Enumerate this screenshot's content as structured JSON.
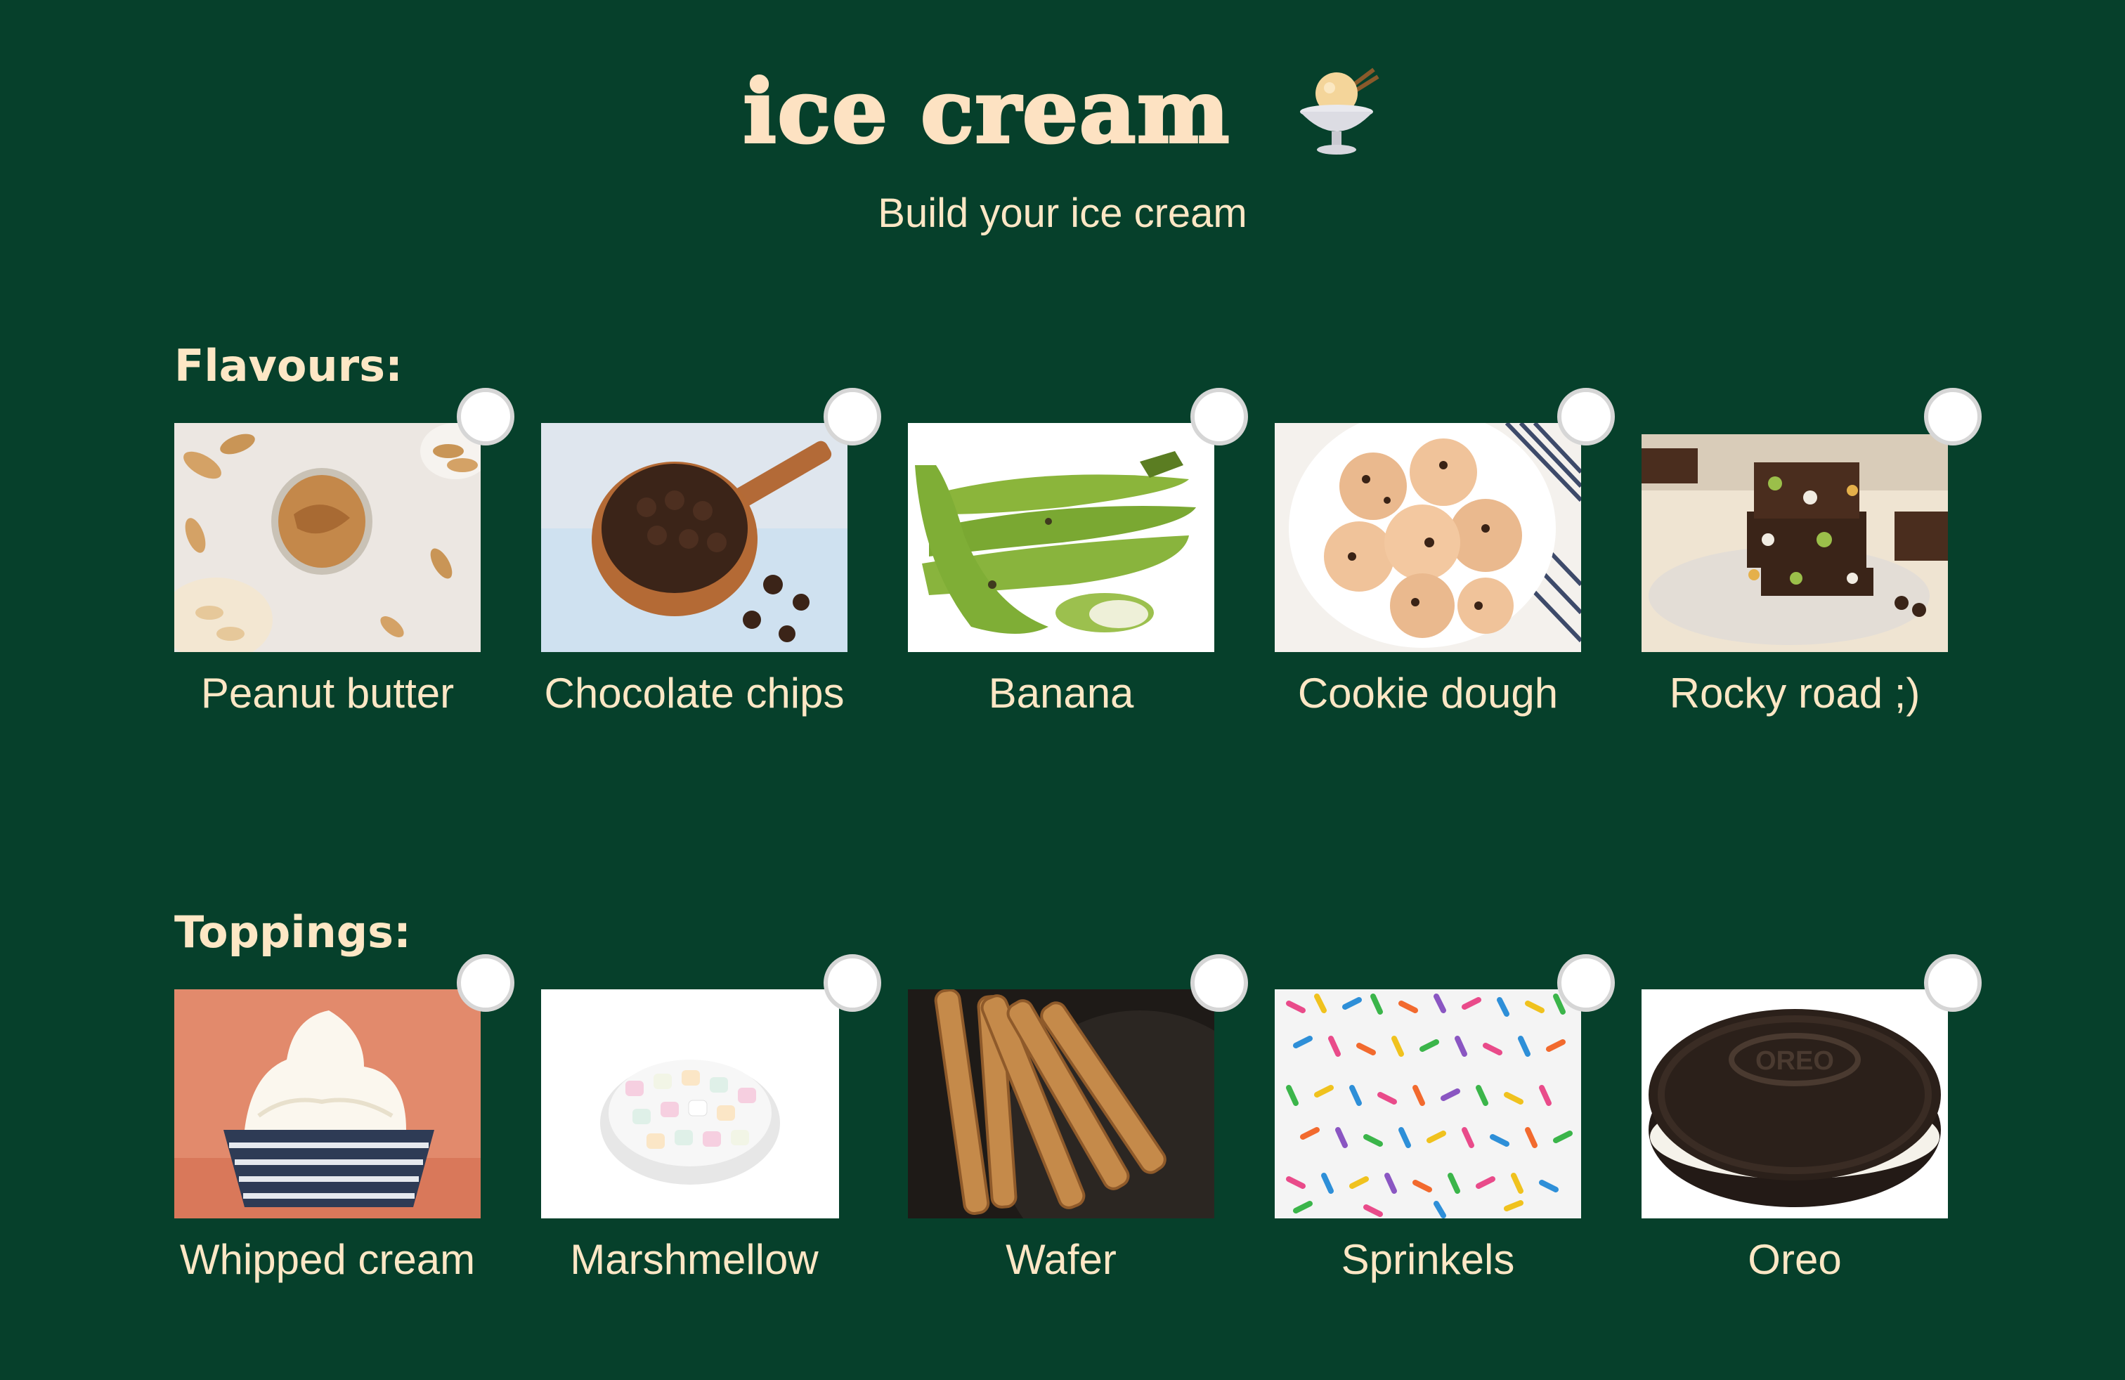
{
  "header": {
    "title": "ice cream",
    "subtitle": "Build your ice cream"
  },
  "colors": {
    "background": "#06402b",
    "accent": "#fde2c2"
  },
  "flavours": {
    "label": "Flavours:",
    "items": [
      {
        "label": "Peanut butter",
        "icon": "peanut-butter-photo",
        "selected": false
      },
      {
        "label": "Chocolate chips",
        "icon": "chocolate-chips-photo",
        "selected": false
      },
      {
        "label": "Banana",
        "icon": "banana-photo",
        "selected": false
      },
      {
        "label": "Cookie dough",
        "icon": "cookie-dough-photo",
        "selected": false
      },
      {
        "label": "Rocky road ;)",
        "icon": "rocky-road-photo",
        "selected": false
      }
    ]
  },
  "toppings": {
    "label": "Toppings:",
    "items": [
      {
        "label": "Whipped cream",
        "icon": "whipped-cream-photo",
        "selected": false
      },
      {
        "label": "Marshmellow",
        "icon": "marshmellow-photo",
        "selected": false
      },
      {
        "label": "Wafer",
        "icon": "wafer-photo",
        "selected": false
      },
      {
        "label": "Sprinkels",
        "icon": "sprinkles-photo",
        "selected": false
      },
      {
        "label": "Oreo",
        "icon": "oreo-photo",
        "selected": false
      }
    ]
  }
}
